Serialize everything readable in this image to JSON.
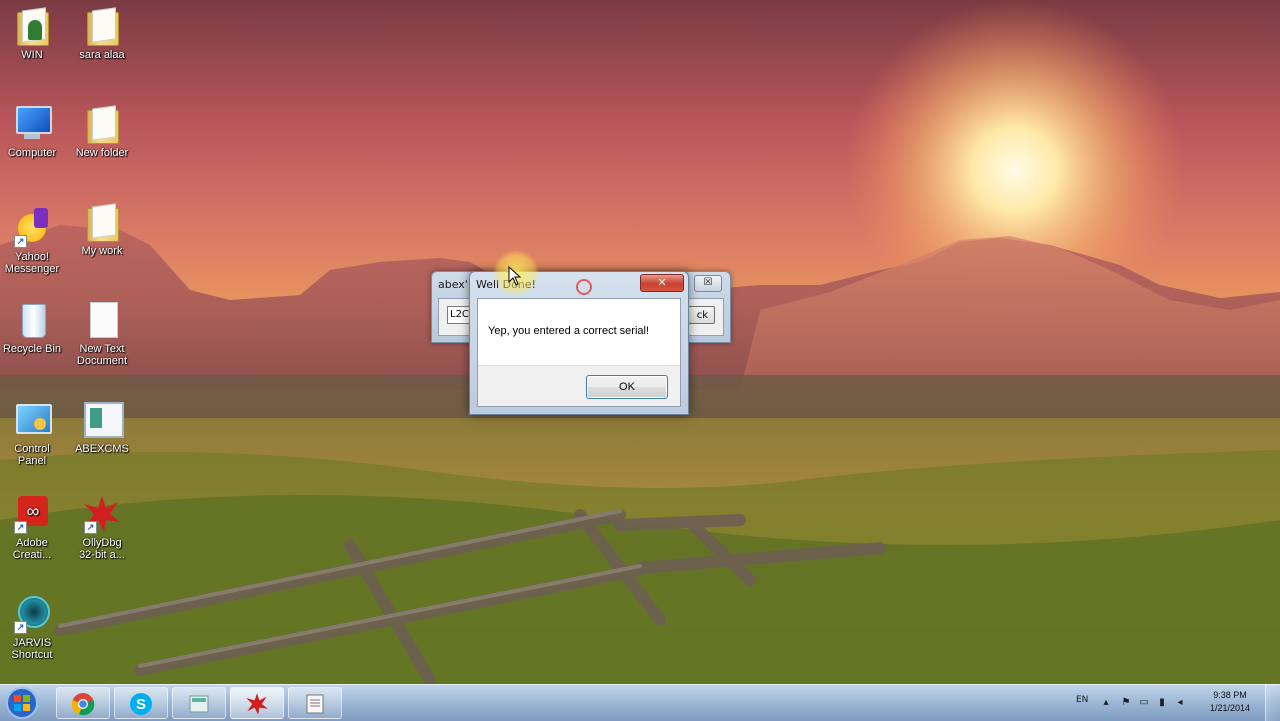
{
  "desktop_icons": [
    {
      "label": "WIN",
      "icon": "folder-user-icon"
    },
    {
      "label": "sara alaa",
      "icon": "folder-icon"
    },
    {
      "label": "Computer",
      "icon": "computer-icon"
    },
    {
      "label": "New folder",
      "icon": "folder-icon"
    },
    {
      "label": "Yahoo!\nMessenger",
      "icon": "yahoo-messenger-icon"
    },
    {
      "label": "My work",
      "icon": "folder-icon"
    },
    {
      "label": "Recycle Bin",
      "icon": "recycle-bin-icon"
    },
    {
      "label": "New Text\nDocument",
      "icon": "text-document-icon"
    },
    {
      "label": "Control\nPanel",
      "icon": "control-panel-icon"
    },
    {
      "label": "ABEXCMS",
      "icon": "application-icon"
    },
    {
      "label": "Adobe\nCreati...",
      "icon": "adobe-creative-cloud-icon"
    },
    {
      "label": "OllyDbg\n32-bit a...",
      "icon": "ollydbg-icon"
    },
    {
      "label": "JARVIS\nShortcut",
      "icon": "jarvis-icon"
    }
  ],
  "abex_window": {
    "title": "abex'",
    "serial_value": "L2C",
    "check_button": "ck",
    "close": "☒"
  },
  "message_box": {
    "title": "Well Done!",
    "text": "Yep, you entered a correct serial!",
    "ok_button": "OK",
    "close": "✕"
  },
  "taskbar": {
    "pinned": [
      "chrome-icon",
      "skype-icon",
      "files-icon",
      "ollydbg-icon",
      "notepad-icon"
    ],
    "tray": {
      "language": "EN",
      "time": "9:38 PM",
      "date": "1/21/2014"
    }
  },
  "colors": {
    "message_close": "#c8412f",
    "taskbar": "#9db3d2",
    "ok_border": "#3c7fb1"
  }
}
